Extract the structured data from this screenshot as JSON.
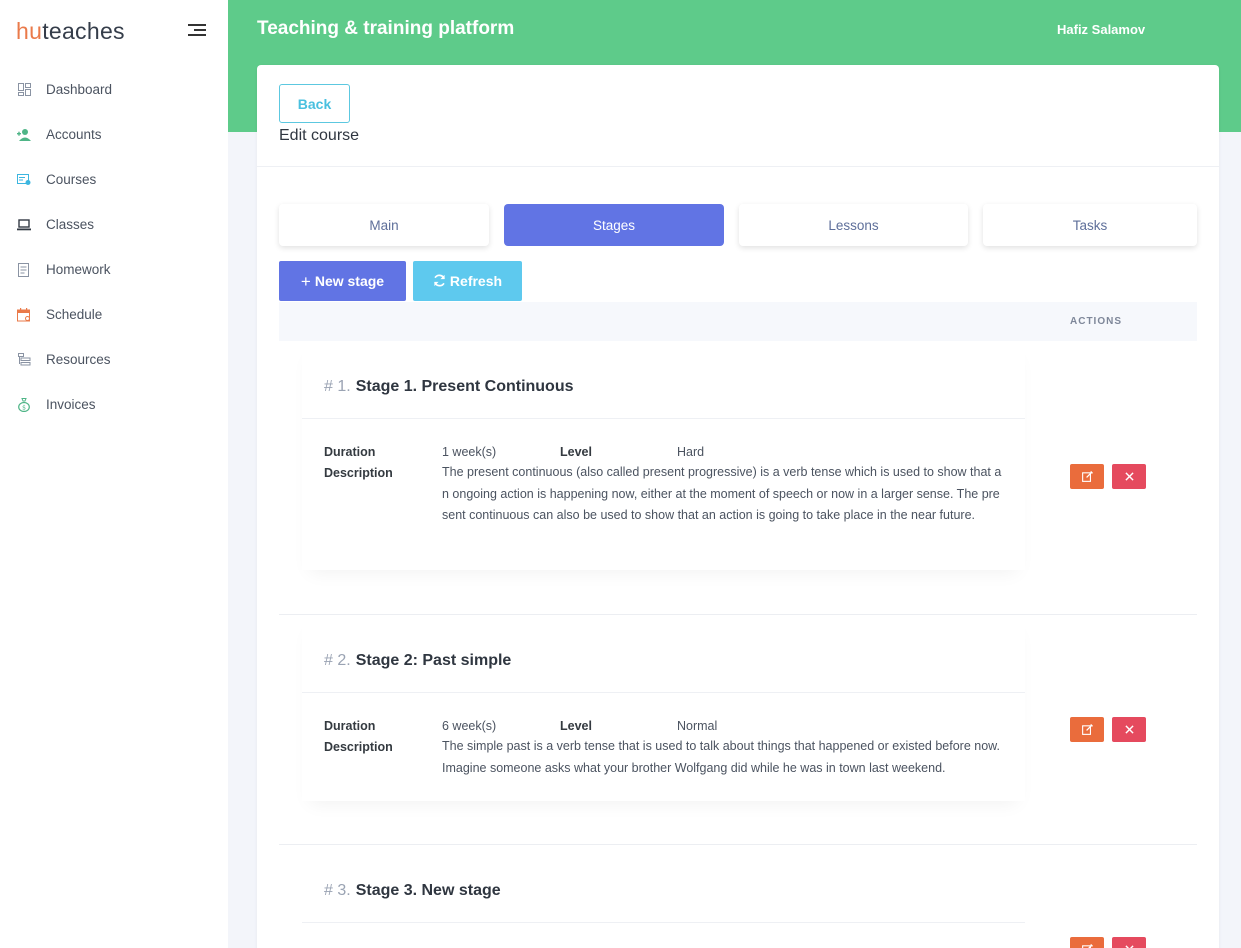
{
  "brand": {
    "part1": "hu",
    "part2": "teaches"
  },
  "sidebar": {
    "items": [
      {
        "label": "Dashboard",
        "icon": "dashboard-icon",
        "color": "#8a93a3"
      },
      {
        "label": "Accounts",
        "icon": "user-add-icon",
        "color": "#4fb587"
      },
      {
        "label": "Courses",
        "icon": "course-icon",
        "color": "#3cb6e0"
      },
      {
        "label": "Classes",
        "icon": "laptop-icon",
        "color": "#333a44"
      },
      {
        "label": "Homework",
        "icon": "document-icon",
        "color": "#8a93a3"
      },
      {
        "label": "Schedule",
        "icon": "calendar-icon",
        "color": "#ea7a4a"
      },
      {
        "label": "Resources",
        "icon": "resources-icon",
        "color": "#8a93a3"
      },
      {
        "label": "Invoices",
        "icon": "money-bag-icon",
        "color": "#4fb587"
      }
    ]
  },
  "header": {
    "title": "Teaching & training platform",
    "user": "Hafiz Salamov"
  },
  "page": {
    "back_label": "Back",
    "title": "Edit course"
  },
  "tabs": [
    {
      "label": "Main",
      "active": false
    },
    {
      "label": "Stages",
      "active": true
    },
    {
      "label": "Lessons",
      "active": false
    },
    {
      "label": "Tasks",
      "active": false
    }
  ],
  "toolbar": {
    "new_label": "New stage",
    "refresh_label": "Refresh"
  },
  "table": {
    "actions_header": "ACTIONS"
  },
  "labels": {
    "duration": "Duration",
    "level": "Level",
    "description": "Description"
  },
  "stages": [
    {
      "num": "# 1.",
      "title": "Stage 1. Present Continuous",
      "duration": "1 week(s)",
      "level": "Hard",
      "description": "The present continuous (also called present progressive) is a verb tense which is used to show that an ongoing action is happening now, either at the moment of speech or now in a larger sense. The present continuous can also be used to show that an action is going to take place in the near future."
    },
    {
      "num": "# 2.",
      "title": "Stage 2: Past simple",
      "duration": "6 week(s)",
      "level": "Normal",
      "description": "The simple past is a verb tense that is used to talk about things that happened or existed before now. Imagine someone asks what your brother Wolfgang did while he was in town last weekend."
    },
    {
      "num": "# 3.",
      "title": "Stage 3. New stage",
      "duration": "",
      "level": "",
      "description": ""
    }
  ],
  "colors": {
    "header": "#5ecb8a",
    "primary": "#6174e4",
    "info": "#5ec9ee",
    "edit": "#ea6c3c",
    "delete": "#e54a5e"
  }
}
